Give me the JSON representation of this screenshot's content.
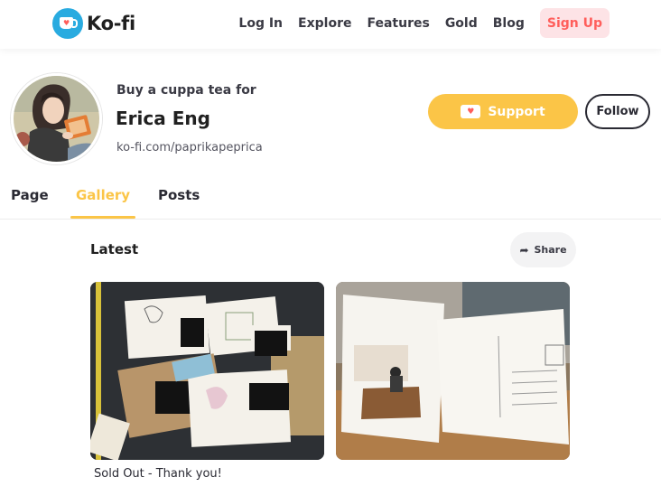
{
  "brand": {
    "name": "Ko-fi",
    "accent": "#29abe0",
    "heart": "#ff5e5b",
    "gold": "#fbc547"
  },
  "nav": {
    "links": [
      "Log In",
      "Explore",
      "Features",
      "Gold",
      "Blog"
    ],
    "signup_label": "Sign Up"
  },
  "profile": {
    "tagline": "Buy a cuppa tea for",
    "name": "Erica Eng",
    "url": "ko-fi.com/paprikapeprica",
    "support_label": "Support",
    "follow_label": "Follow"
  },
  "tabs": [
    {
      "label": "Page",
      "active": false
    },
    {
      "label": "Gallery",
      "active": true
    },
    {
      "label": "Posts",
      "active": false
    }
  ],
  "gallery": {
    "section_title": "Latest",
    "share_label": "Share",
    "items": [
      {
        "caption": "Sold Out - Thank you!"
      },
      {
        "caption": ""
      }
    ]
  }
}
